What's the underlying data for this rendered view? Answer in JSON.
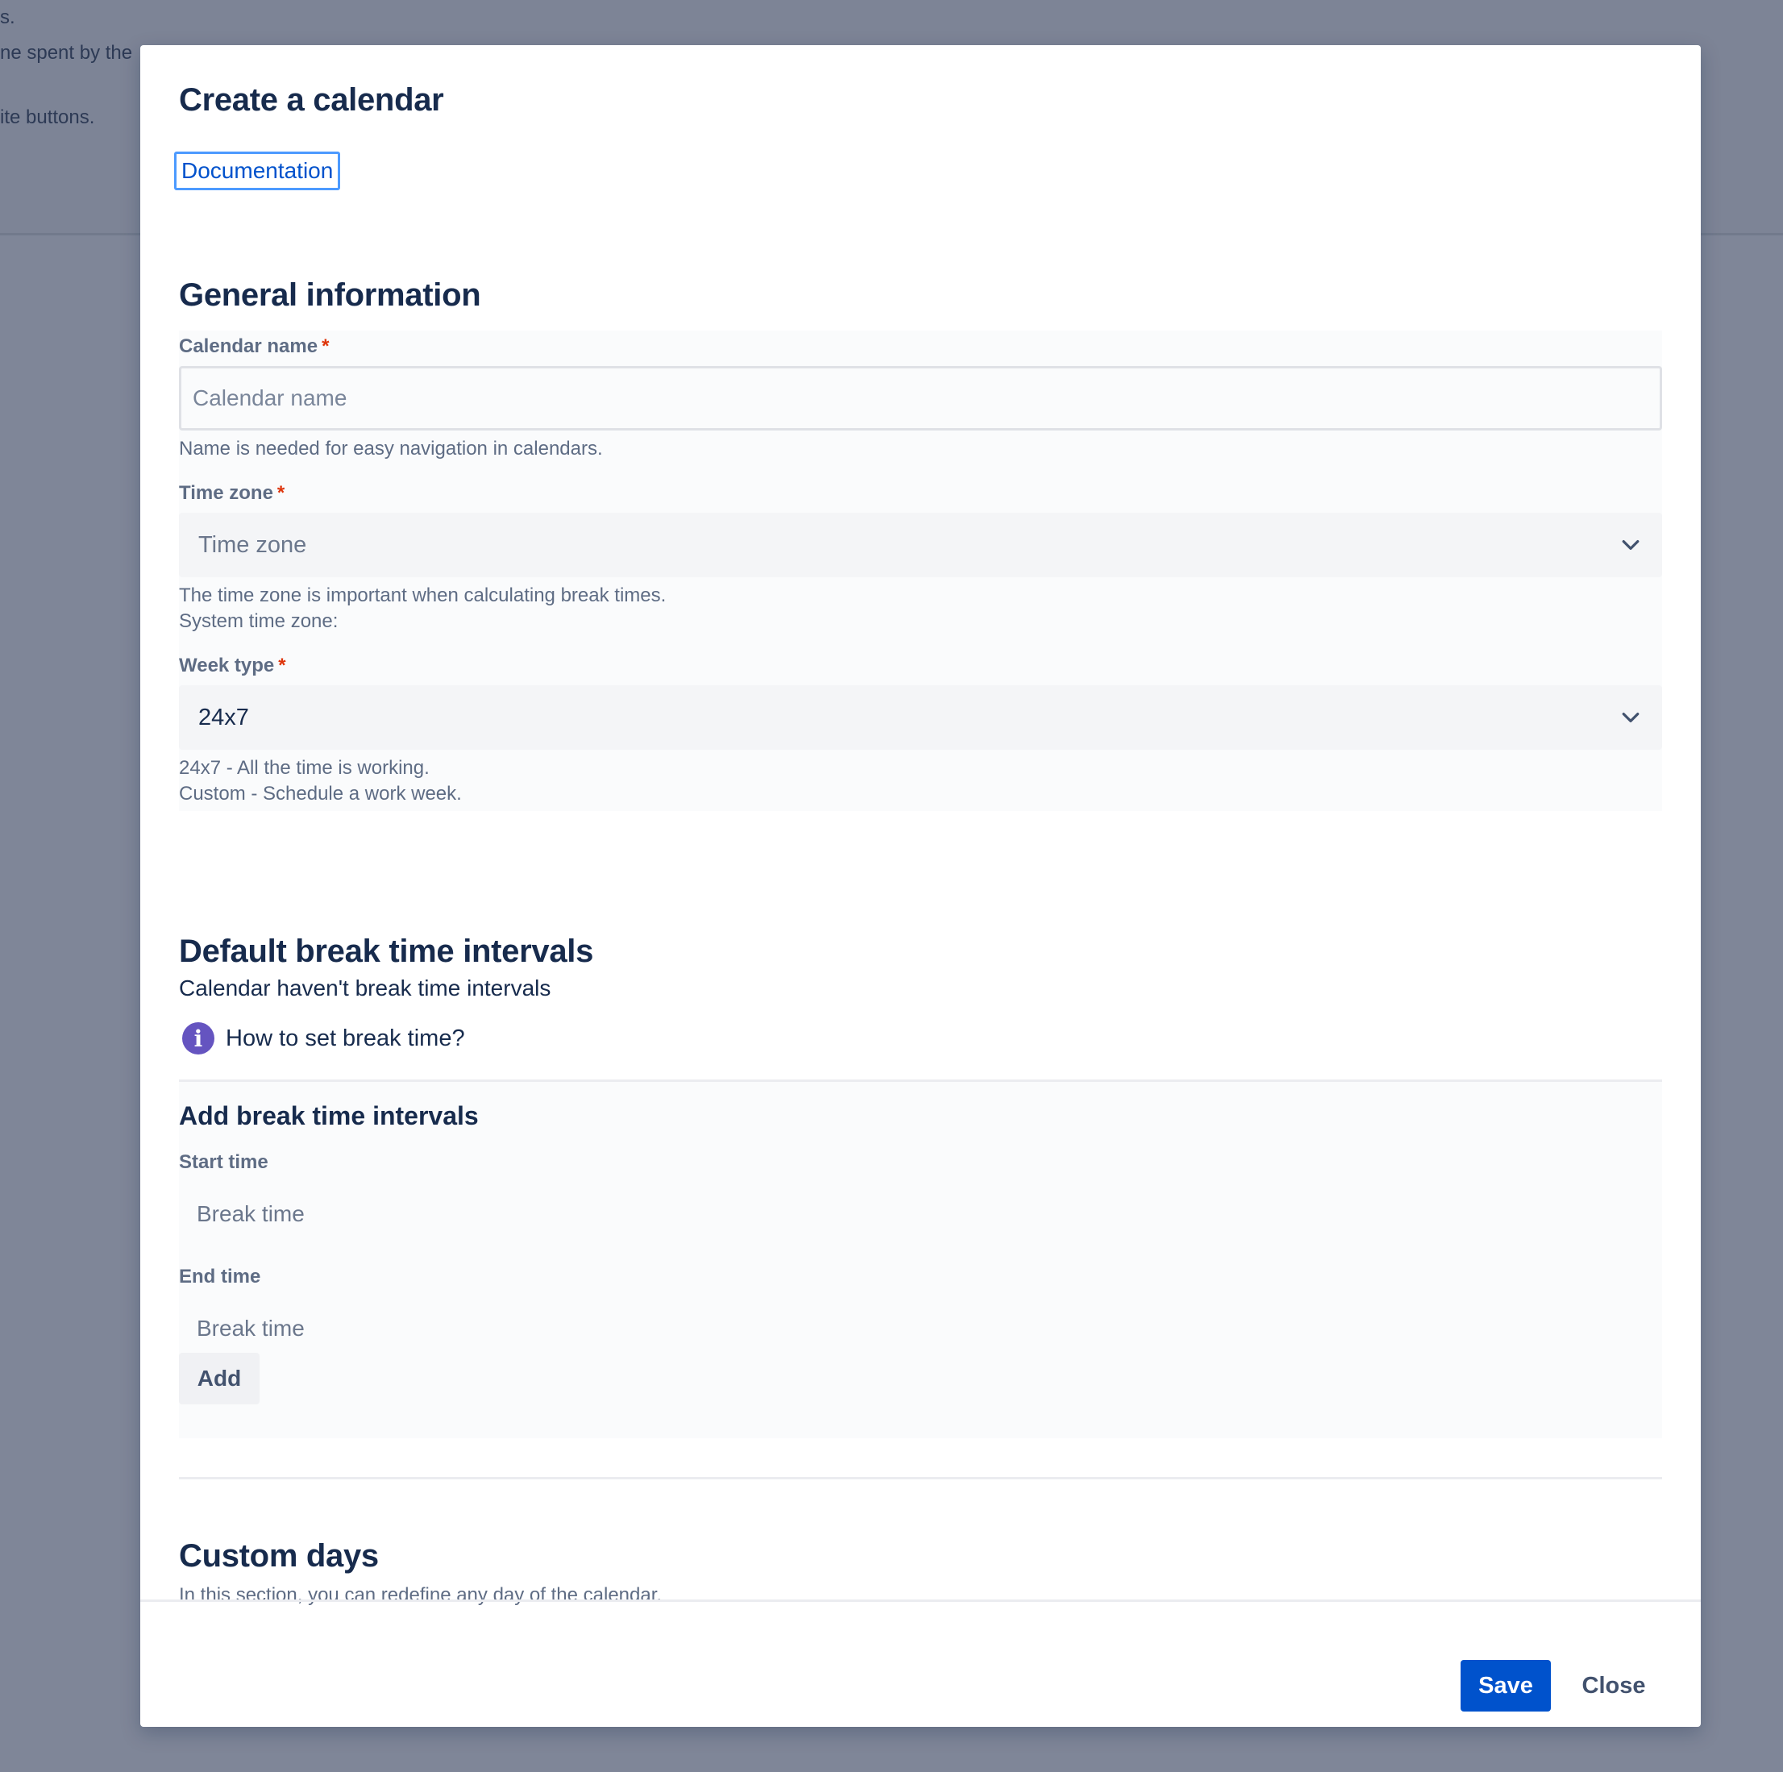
{
  "background": {
    "line1": "s.",
    "line2": "ne spent by the",
    "line3": "ite buttons."
  },
  "modal": {
    "title": "Create a calendar",
    "documentation_link": "Documentation",
    "general": {
      "heading": "General information",
      "calendar_name": {
        "label": "Calendar name",
        "required": "*",
        "placeholder": "Calendar name",
        "helper": "Name is needed for easy navigation in calendars."
      },
      "time_zone": {
        "label": "Time zone",
        "required": "*",
        "placeholder": "Time zone",
        "helper1": "The time zone is important when calculating break times.",
        "helper2": "System time zone:"
      },
      "week_type": {
        "label": "Week type",
        "required": "*",
        "value": "24x7",
        "helper1": "24x7 - All the time is working.",
        "helper2": "Custom - Schedule a work week."
      }
    },
    "breaks": {
      "heading": "Default break time intervals",
      "empty_text": "Calendar haven't break time intervals",
      "info_link": "How to set break time?",
      "info_icon_glyph": "i",
      "add_heading": "Add break time intervals",
      "start_label": "Start time",
      "start_placeholder": "Break time",
      "end_label": "End time",
      "end_placeholder": "Break time",
      "add_button": "Add"
    },
    "custom_days": {
      "heading": "Custom days",
      "description": "In this section, you can redefine any day of the calendar."
    },
    "footer": {
      "save_label": "Save",
      "close_label": "Close"
    }
  },
  "colors": {
    "primary": "#0052cc",
    "info_icon": "#6554c0",
    "required": "#de350b",
    "overlay": "#7f8698"
  }
}
